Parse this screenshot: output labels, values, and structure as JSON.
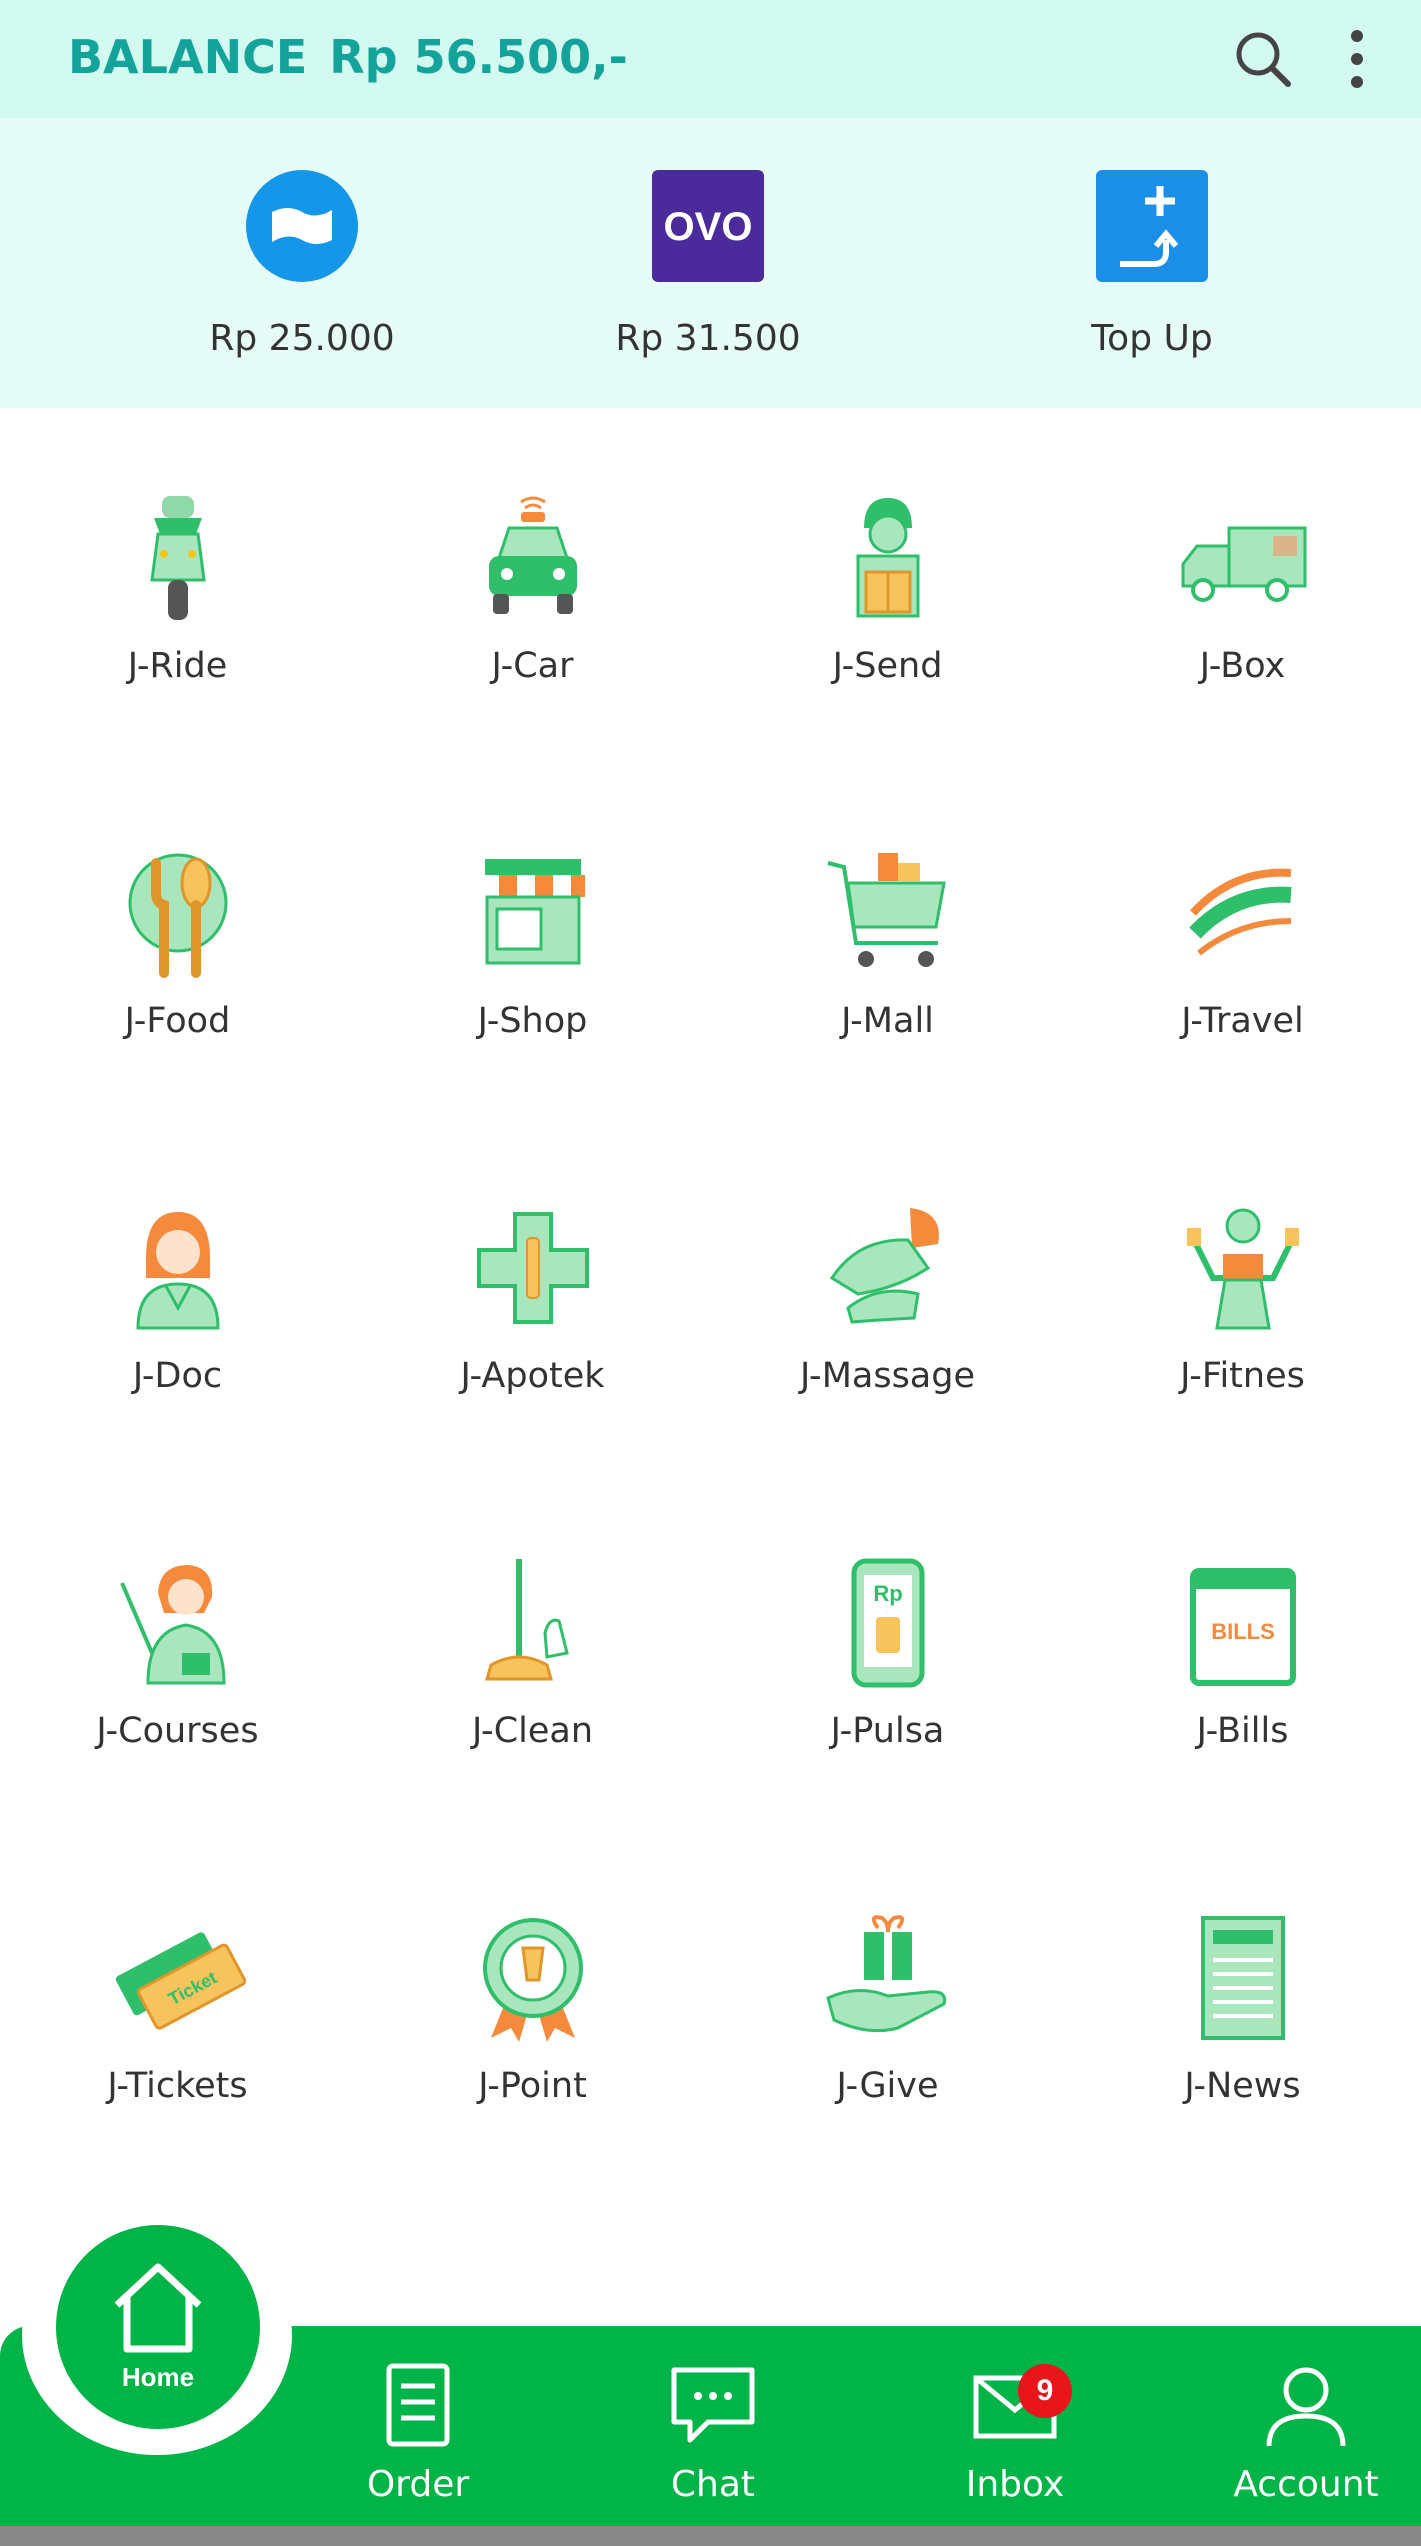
{
  "header": {
    "balance_label": "BALANCE",
    "balance_amount": "Rp 56.500,-",
    "icons": [
      "search-icon",
      "more-vertical-icon"
    ]
  },
  "wallets": [
    {
      "label": "Rp 25.000",
      "icon": "cash-icon"
    },
    {
      "label": "Rp 31.500",
      "icon": "ovo-icon",
      "icon_text": "OVO"
    },
    {
      "label": "Top Up",
      "icon": "top-up-icon"
    }
  ],
  "services": [
    {
      "label": "J-Ride",
      "icon": "scooter-icon"
    },
    {
      "label": "J-Car",
      "icon": "car-icon"
    },
    {
      "label": "J-Send",
      "icon": "courier-icon"
    },
    {
      "label": "J-Box",
      "icon": "truck-icon"
    },
    {
      "label": "J-Food",
      "icon": "fork-spoon-icon"
    },
    {
      "label": "J-Shop",
      "icon": "store-icon"
    },
    {
      "label": "J-Mall",
      "icon": "shopping-cart-icon"
    },
    {
      "label": "J-Travel",
      "icon": "travel-icon"
    },
    {
      "label": "J-Doc",
      "icon": "doctor-icon"
    },
    {
      "label": "J-Apotek",
      "icon": "pharmacy-cross-icon"
    },
    {
      "label": "J-Massage",
      "icon": "massage-icon"
    },
    {
      "label": "J-Fitnes",
      "icon": "fitness-icon"
    },
    {
      "label": "J-Courses",
      "icon": "teacher-icon"
    },
    {
      "label": "J-Clean",
      "icon": "broom-icon"
    },
    {
      "label": "J-Pulsa",
      "icon": "phone-credit-icon",
      "icon_text": "Rp"
    },
    {
      "label": "J-Bills",
      "icon": "bills-icon",
      "icon_text": "BILLS"
    },
    {
      "label": "J-Tickets",
      "icon": "ticket-icon",
      "icon_text": "Ticket"
    },
    {
      "label": "J-Point",
      "icon": "badge-icon"
    },
    {
      "label": "J-Give",
      "icon": "gift-hand-icon"
    },
    {
      "label": "J-News",
      "icon": "newspaper-icon"
    }
  ],
  "nav": {
    "home": "Home",
    "items": [
      {
        "label": "Order",
        "icon": "order-icon"
      },
      {
        "label": "Chat",
        "icon": "chat-icon"
      },
      {
        "label": "Inbox",
        "icon": "inbox-icon"
      },
      {
        "label": "Account",
        "icon": "account-icon"
      }
    ],
    "inbox_badge": "9"
  },
  "colors": {
    "brand_green": "#00b447",
    "header_bg": "#d3faf0",
    "header_text": "#14a39a",
    "accent_orange": "#f58a3c",
    "badge_red": "#e8161b"
  }
}
